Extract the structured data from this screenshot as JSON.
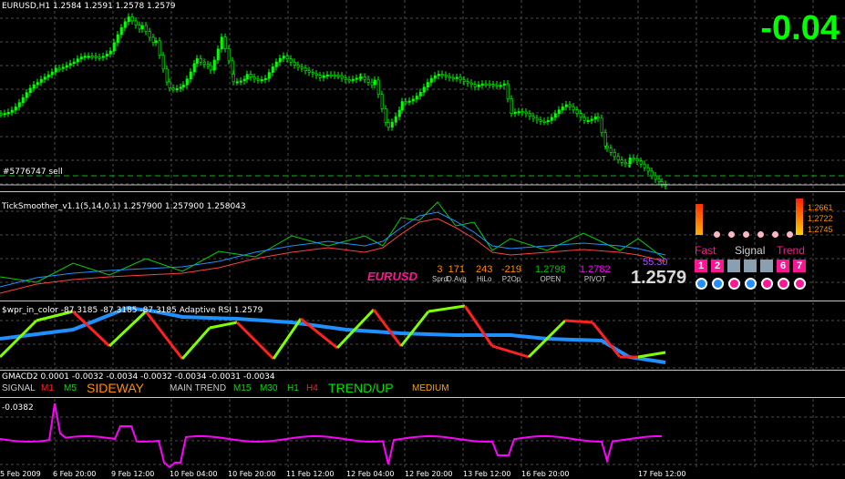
{
  "main": {
    "header": "EURUSD,H1  1.2584 1.2591 1.2578 1.2579",
    "big_value": "-0.04",
    "order_label": "#5776747 sell"
  },
  "ticksmoother": {
    "header": "TickSmoother_v1.1(5,14,0.1) 1.257900 1.257900 1.258043",
    "symbol": "EURUSD",
    "stats": [
      {
        "value": "3",
        "label": "Sprd",
        "color": "#ff8c00"
      },
      {
        "value": "171",
        "label": "D.Avg",
        "color": "#ff8c00"
      },
      {
        "value": "243",
        "label": "HiLo",
        "color": "#ff8c00"
      },
      {
        "value": "-219",
        "label": "P2Op",
        "color": "#ff8c00"
      },
      {
        "value": "1.2798",
        "label": "OPEN",
        "color": "#00c000"
      },
      {
        "value": "1.2782",
        "label": "PIVOT",
        "color": "#ff00ff"
      }
    ],
    "pct": "55.30",
    "price": "1.2579",
    "levels": [
      "1.2661",
      "1.2722",
      "1.2745"
    ],
    "mode_labels": {
      "fast": "Fast",
      "signal": "Signal",
      "trend": "Trend"
    },
    "squares": [
      "1",
      "2",
      "",
      "",
      "",
      "6",
      "7"
    ]
  },
  "wpr": {
    "header": "$wpr_in_color -87.3185 -87.3185 -87.3185  Adaptive RSI 1.2579"
  },
  "gmacd": {
    "header": "GMACD2 0.0001 -0.0032 -0.0034 -0.0032 -0.0034 -0.0031 -0.0034",
    "signal_label": "SIGNAL",
    "signal_tfs": [
      {
        "tf": "M1",
        "color": "#ff2020"
      },
      {
        "tf": "M5",
        "color": "#00e000"
      }
    ],
    "signal_state": "SIDEWAY",
    "main_label": "MAIN TREND",
    "main_tfs": [
      {
        "tf": "M15",
        "color": "#00e000"
      },
      {
        "tf": "M30",
        "color": "#00e000"
      },
      {
        "tf": "H1",
        "color": "#00e000"
      },
      {
        "tf": "H4",
        "color": "#ff2020"
      }
    ],
    "main_state": "TREND/UP",
    "strength": "MEDIUM"
  },
  "bottom": {
    "value": "-0.0382"
  },
  "time_axis": [
    "5 Feb 2009",
    "6 Feb 20:00",
    "9 Feb 12:00",
    "10 Feb 04:00",
    "10 Feb 20:00",
    "11 Feb 12:00",
    "12 Feb 04:00",
    "12 Feb 20:00",
    "13 Feb 12:00",
    "16 Feb 20:00",
    "17 Feb 12:00"
  ],
  "colors": {
    "bull": "#00ff00",
    "grid": "#4a4a4a",
    "magenta": "#ff00ff",
    "blue": "#1e90ff"
  }
}
